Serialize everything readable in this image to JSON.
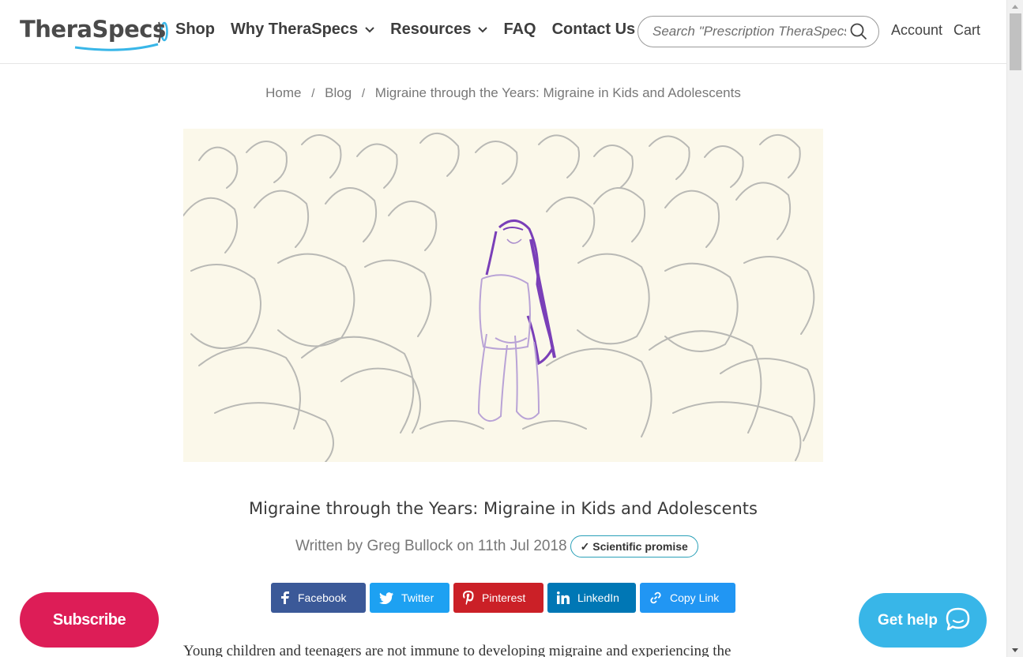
{
  "brand": {
    "name": "TheraSpecs",
    "accent": "#38b6e8"
  },
  "nav": {
    "items": [
      {
        "label": "Shop",
        "has_dropdown": false
      },
      {
        "label": "Why TheraSpecs",
        "has_dropdown": true
      },
      {
        "label": "Resources",
        "has_dropdown": true
      },
      {
        "label": "FAQ",
        "has_dropdown": false
      },
      {
        "label": "Contact Us",
        "has_dropdown": false
      }
    ],
    "search_placeholder": "Search \"Prescription TheraSpecs\"",
    "account_label": "Account",
    "cart_label": "Cart"
  },
  "breadcrumb": {
    "home": "Home",
    "blog": "Blog",
    "current": "Migraine through the Years: Migraine in Kids and Adolescents",
    "separator": "/"
  },
  "article": {
    "title": "Migraine through the Years: Migraine in Kids and Adolescents",
    "byline": "Written by Greg Bullock on 11th Jul 2018",
    "badge": "✓ Scientific promise",
    "intro": "Young children and teenagers are not immune to developing migraine and experiencing the"
  },
  "share": {
    "facebook": "Facebook",
    "twitter": "Twitter",
    "pinterest": "Pinterest",
    "linkedin": "LinkedIn",
    "copy_link": "Copy Link"
  },
  "widgets": {
    "subscribe": "Subscribe",
    "get_help": "Get help"
  },
  "colors": {
    "facebook": "#3b5998",
    "twitter": "#1da1f2",
    "pinterest": "#cb2027",
    "linkedin": "#0077b5",
    "copy_link": "#2196f3",
    "subscribe": "#dd1d57",
    "hero_background": "#fbf8ea",
    "girl_hair": "#7a3fb8"
  },
  "icons": {
    "search": "search-icon",
    "chevron": "chevron-down-icon",
    "facebook": "facebook-icon",
    "twitter": "twitter-icon",
    "pinterest": "pinterest-icon",
    "linkedin": "linkedin-icon",
    "link": "link-icon",
    "chat": "chat-bubble-icon"
  }
}
